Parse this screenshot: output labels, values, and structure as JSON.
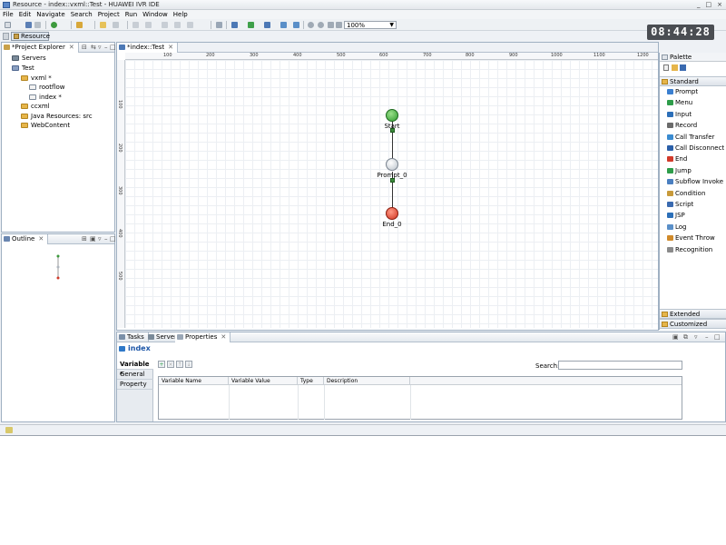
{
  "window": {
    "title": "Resource - index::vxml::Test - HUAWEI IVR IDE",
    "controls": [
      "_",
      "□",
      "×"
    ]
  },
  "menu": [
    "File",
    "Edit",
    "Navigate",
    "Search",
    "Project",
    "Run",
    "Window",
    "Help"
  ],
  "toolbar": {
    "zoom": "100%"
  },
  "clock": "08:44:28",
  "perspective": {
    "label": "Resource"
  },
  "project_explorer": {
    "tab": "*Project Explorer",
    "items": [
      {
        "label": "Servers",
        "icon": "servers-icon",
        "level": 1
      },
      {
        "label": "Test",
        "icon": "project-icon",
        "level": 1
      },
      {
        "label": "vxml *",
        "icon": "folder-icon",
        "level": 2
      },
      {
        "label": "rootflow",
        "icon": "file-icon",
        "level": 3
      },
      {
        "label": "index *",
        "icon": "file-icon",
        "level": 3
      },
      {
        "label": "ccxml",
        "icon": "folder-icon",
        "level": 2
      },
      {
        "label": "Java Resources: src",
        "icon": "folder-icon",
        "level": 2
      },
      {
        "label": "WebContent",
        "icon": "folder-icon",
        "level": 2
      }
    ]
  },
  "outline": {
    "tab": "Outline"
  },
  "editor": {
    "tab": "*index::Test",
    "ruler_h": [
      "100",
      "200",
      "300",
      "400",
      "500",
      "600",
      "700",
      "800",
      "900",
      "1000",
      "1100",
      "1200"
    ],
    "ruler_v": [
      "100",
      "200",
      "300",
      "400",
      "500"
    ],
    "nodes": {
      "start": "Start",
      "prompt": "Prompt_0",
      "end": "End_0"
    }
  },
  "palette": {
    "title": "Palette",
    "groups": {
      "standard": "Standard",
      "extended": "Extended",
      "customized": "Customized"
    },
    "items": [
      {
        "label": "Prompt",
        "icon": "prompt-icon",
        "color": "#3a7fd0"
      },
      {
        "label": "Menu",
        "icon": "menu-icon",
        "color": "#2e9d4a"
      },
      {
        "label": "Input",
        "icon": "input-icon",
        "color": "#2c6fb8"
      },
      {
        "label": "Record",
        "icon": "record-icon",
        "color": "#6a6a6a"
      },
      {
        "label": "Call Transfer",
        "icon": "call-transfer-icon",
        "color": "#3a8bd0"
      },
      {
        "label": "Call Disconnect",
        "icon": "call-disconnect-icon",
        "color": "#2b5fa8"
      },
      {
        "label": "End",
        "icon": "end-icon",
        "color": "#d23a2a"
      },
      {
        "label": "Jump",
        "icon": "jump-icon",
        "color": "#2e9d4a"
      },
      {
        "label": "Subflow Invoke",
        "icon": "subflow-icon",
        "color": "#4a7fc0"
      },
      {
        "label": "Condition",
        "icon": "condition-icon",
        "color": "#c89a3a"
      },
      {
        "label": "Script",
        "icon": "script-icon",
        "color": "#3a6ab0"
      },
      {
        "label": "JSP",
        "icon": "jsp-icon",
        "color": "#2c6fb8"
      },
      {
        "label": "Log",
        "icon": "log-icon",
        "color": "#5a8fc8"
      },
      {
        "label": "Event Throw",
        "icon": "event-throw-icon",
        "color": "#d08a2a"
      },
      {
        "label": "Recognition",
        "icon": "recognition-icon",
        "color": "#8a8a8a"
      }
    ]
  },
  "bottom": {
    "tabs": [
      "Tasks",
      "Servers",
      "Properties"
    ],
    "title": "index",
    "side_tabs": [
      "Variable *",
      "General",
      "Property"
    ],
    "search_label": "Search:",
    "columns": [
      "Variable Name",
      "Variable Value",
      "Type",
      "Description"
    ]
  }
}
